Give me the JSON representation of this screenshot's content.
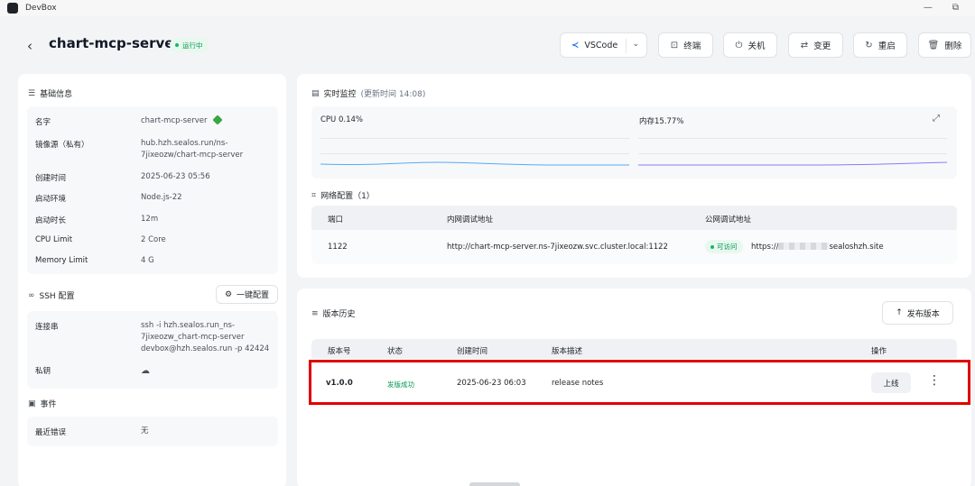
{
  "window": {
    "title": "DevBox",
    "minimize_glyph": "—",
    "restore_glyph": "⧉"
  },
  "header": {
    "back_glyph": "‹",
    "title": "chart-mcp-server",
    "status": "运行中",
    "actions": {
      "vscode": "VSCode",
      "terminal": "终端",
      "shutdown": "关机",
      "change": "变更",
      "restart": "重启",
      "delete": "删除"
    }
  },
  "basic_info": {
    "title": "基础信息",
    "rows": [
      {
        "key": "名字",
        "value": "chart-mcp-server"
      },
      {
        "key": "镜像源（私有）",
        "value1": "hub.hzh.sealos.run/ns-",
        "value2": "7jixeozw/chart-mcp-server"
      },
      {
        "key": "创建时间",
        "value": "2025-06-23 05:56"
      },
      {
        "key": "启动环境",
        "value": "Node.js-22"
      },
      {
        "key": "启动时长",
        "value": "12m"
      },
      {
        "key": "CPU Limit",
        "value": "2 Core"
      },
      {
        "key": "Memory Limit",
        "value": "4 G"
      }
    ]
  },
  "ssh": {
    "title": "SSH 配置",
    "one_click": "一键配置",
    "conn_key": "连接串",
    "conn_line1": "ssh -i hzh.sealos.run_ns-",
    "conn_line2": "7jixeozw_chart-mcp-server",
    "conn_line3": "devbox@hzh.sealos.run -p 42424",
    "private_key": "私钥"
  },
  "events": {
    "title": "事件",
    "recent_error_key": "最近错误",
    "recent_error_value": "无"
  },
  "monitor": {
    "title": "实时监控",
    "updated": "(更新时间  14:08)",
    "cpu_label": "CPU 0.14%",
    "mem_label": "内存15.77%"
  },
  "network": {
    "title": "网络配置（1）",
    "headers": [
      "端口",
      "内网调试地址",
      "公网调试地址"
    ],
    "row": {
      "port": "1122",
      "internal": "http://chart-mcp-server.ns-7jixeozw.svc.cluster.local:1122",
      "status": "可访问",
      "public_prefix": "https://",
      "public_suffix": "sealoshzh.site"
    }
  },
  "versions": {
    "title": "版本历史",
    "publish": "发布版本",
    "headers": [
      "版本号",
      "状态",
      "创建时间",
      "版本描述",
      "操作"
    ],
    "rows": [
      {
        "version": "v1.0.0",
        "status": "发版成功",
        "created": "2025-06-23 06:03",
        "desc": "release notes",
        "action": "上线"
      }
    ]
  },
  "colors": {
    "accent_green": "#12b76a",
    "highlight_red": "#e00000",
    "cpu_line": "#5aa9f0",
    "mem_line": "#8b7cf0"
  },
  "chart_data": [
    {
      "type": "area",
      "title": "CPU 0.14%",
      "series": [
        {
          "values": [
            0.14
          ]
        }
      ]
    },
    {
      "type": "area",
      "title": "内存15.77%",
      "series": [
        {
          "values": [
            15.77
          ]
        }
      ]
    }
  ]
}
